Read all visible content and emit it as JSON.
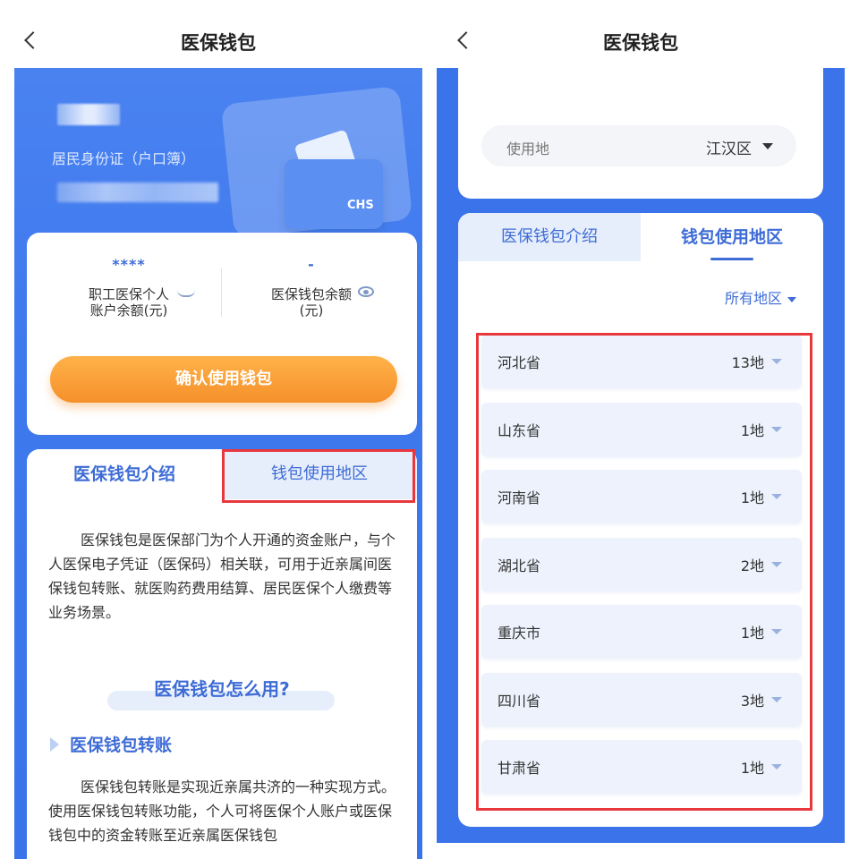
{
  "left": {
    "nav_title": "医保钱包",
    "id_type": "居民身份证（户口簿）",
    "balance": {
      "employee_value": "****",
      "employee_label_line1": "职工医保个人",
      "employee_label_line2": "账户余额(元)",
      "wallet_value": "-",
      "wallet_label_line1": "医保钱包余额",
      "wallet_label_line2": "(元)"
    },
    "logo_text": "CHS",
    "confirm_button": "确认使用钱包",
    "tabs": {
      "intro": "医保钱包介绍",
      "regions": "钱包使用地区"
    },
    "intro_paragraph": "医保钱包是医保部门为个人开通的资金账户，与个人医保电子凭证（医保码）相关联，可用于近亲属间医保钱包转账、就医购药费用结算、居民医保个人缴费等业务场景。",
    "howto_title": "医保钱包怎么用?",
    "transfer_title": "医保钱包转账",
    "transfer_paragraph": "医保钱包转账是实现近亲属共济的一种实现方式。使用医保钱包转账功能，个人可将医保个人账户或医保钱包中的资金转账至近亲属医保钱包"
  },
  "right": {
    "nav_title": "医保钱包",
    "location_label": "使用地",
    "location_value": "江汉区",
    "tabs": {
      "intro": "医保钱包介绍",
      "regions": "钱包使用地区"
    },
    "filter_label": "所有地区",
    "regions": [
      {
        "name": "河北省",
        "count": "13地"
      },
      {
        "name": "山东省",
        "count": "1地"
      },
      {
        "name": "河南省",
        "count": "1地"
      },
      {
        "name": "湖北省",
        "count": "2地"
      },
      {
        "name": "重庆市",
        "count": "1地"
      },
      {
        "name": "四川省",
        "count": "3地"
      },
      {
        "name": "甘肃省",
        "count": "1地"
      }
    ]
  },
  "colors": {
    "brand_blue": "#3e6cd6",
    "panel_blue": "#3a73ea",
    "orange": "#f5902a",
    "highlight_red": "#e8383d"
  }
}
